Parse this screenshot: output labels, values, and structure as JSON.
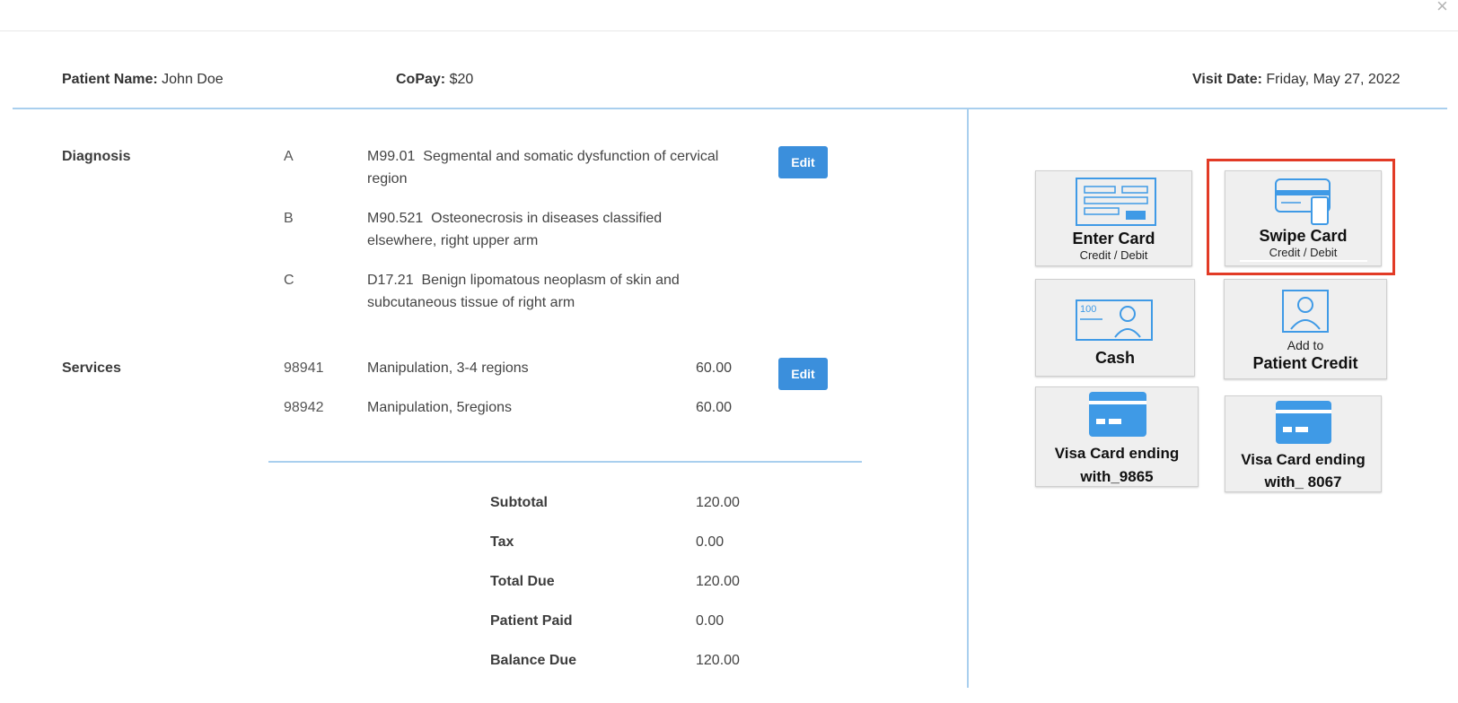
{
  "dialog": {
    "close_glyph": "×"
  },
  "header": {
    "patient_name_label": "Patient Name:",
    "patient_name": "John Doe",
    "copay_label": "CoPay:",
    "copay": "$20",
    "visit_date_label": "Visit Date:",
    "visit_date": "Friday, May 27, 2022"
  },
  "diagnosis": {
    "label": "Diagnosis",
    "edit_label": "Edit",
    "items": [
      {
        "letter": "A",
        "code": "M99.01",
        "description": "Segmental and somatic dysfunction of cervical region"
      },
      {
        "letter": "B",
        "code": "M90.521",
        "description": "Osteonecrosis in diseases classified elsewhere, right upper arm"
      },
      {
        "letter": "C",
        "code": "D17.21",
        "description": "Benign lipomatous neoplasm of skin and subcutaneous tissue of right arm"
      }
    ]
  },
  "services": {
    "label": "Services",
    "edit_label": "Edit",
    "items": [
      {
        "code": "98941",
        "description": "Manipulation, 3-4 regions",
        "amount": "60.00"
      },
      {
        "code": "98942",
        "description": "Manipulation, 5regions",
        "amount": "60.00"
      }
    ]
  },
  "summary": [
    {
      "label": "Subtotal",
      "value": "120.00"
    },
    {
      "label": "Tax",
      "value": "0.00"
    },
    {
      "label": "Total Due",
      "value": "120.00"
    },
    {
      "label": "Patient Paid",
      "value": "0.00"
    },
    {
      "label": "Balance Due",
      "value": "120.00"
    }
  ],
  "payment_options": {
    "enter_card": {
      "title": "Enter Card",
      "subtitle": "Credit / Debit",
      "icon": "card-form-icon"
    },
    "swipe_card": {
      "title": "Swipe Card",
      "subtitle": "Credit / Debit",
      "icon": "card-swipe-icon",
      "highlighted": true
    },
    "cash": {
      "title": "Cash",
      "icon": "cash-bill-icon",
      "bill_text": "100"
    },
    "patient_credit": {
      "pre": "Add to",
      "title": "Patient Credit",
      "icon": "person-icon"
    },
    "visa_9865": {
      "line1": "Visa Card ending",
      "line2": "with_9865",
      "icon": "credit-card-icon"
    },
    "visa_8067": {
      "line1": "Visa Card ending",
      "line2": "with_ 8067",
      "icon": "credit-card-icon"
    }
  },
  "colors": {
    "accent": "#3b8fdc",
    "divider": "#a9cfee",
    "icon_blue": "#3f9ae6",
    "highlight": "#e23b26"
  }
}
